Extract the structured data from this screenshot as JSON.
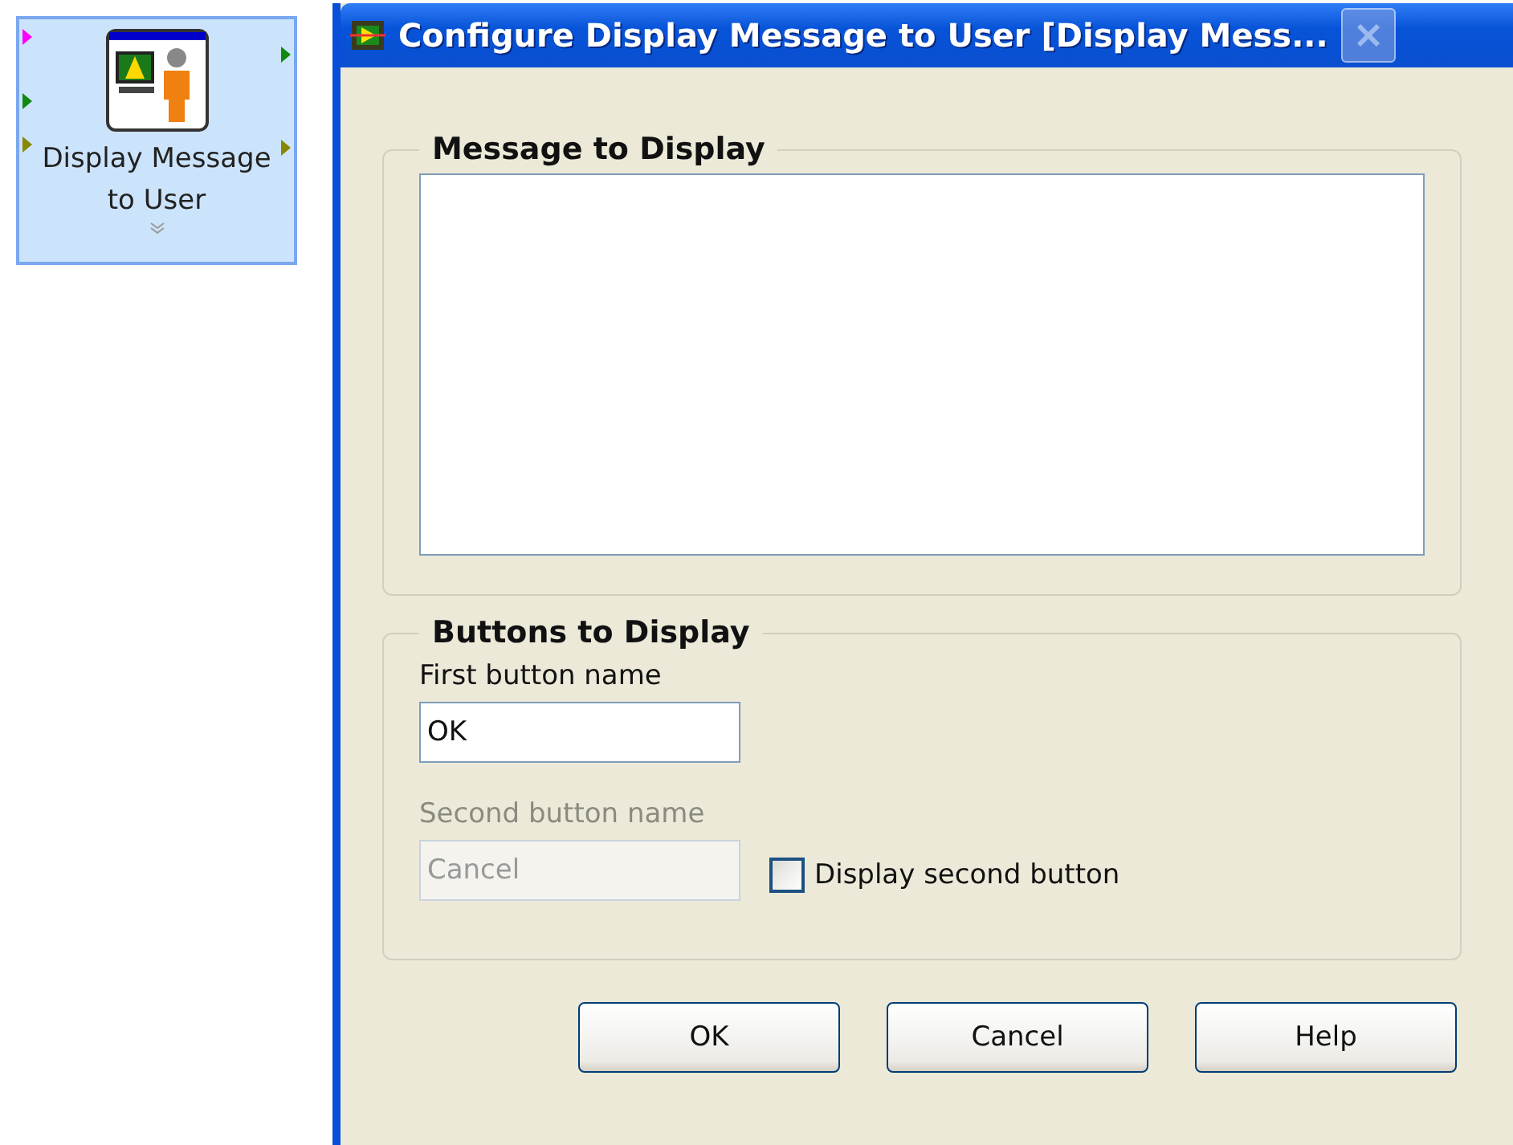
{
  "node": {
    "label": "Display Message to User"
  },
  "dialog": {
    "title": "Configure Display Message to User [Display Mess...",
    "close_disabled": true
  },
  "message_group": {
    "legend": "Message to Display"
  },
  "buttons_group": {
    "legend": "Buttons to Display",
    "fields": [
      {
        "label": "First button name",
        "value": "OK",
        "disabled": false
      },
      {
        "label": "Second button name",
        "value": "Cancel",
        "disabled": true
      }
    ],
    "checkbox": {
      "label": "Display second button",
      "checked": false
    }
  },
  "buttons": [
    "OK",
    "Cancel",
    "Help"
  ]
}
